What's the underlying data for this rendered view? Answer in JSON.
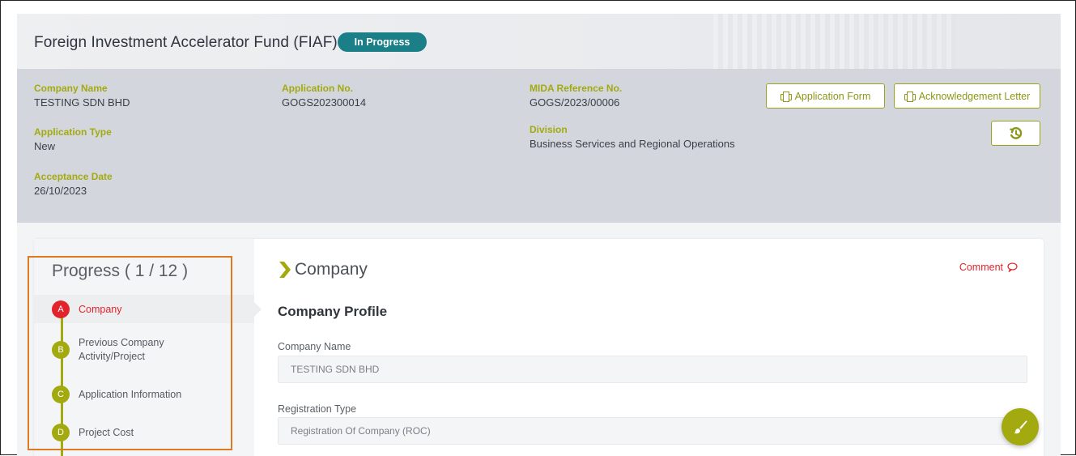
{
  "header": {
    "title": "Foreign Investment Accelerator Fund (FIAF)",
    "status": "In Progress"
  },
  "info": {
    "company_name": {
      "label": "Company Name",
      "value": "TESTING SDN BHD"
    },
    "application_type": {
      "label": "Application Type",
      "value": "New"
    },
    "acceptance_date": {
      "label": "Acceptance Date",
      "value": "26/10/2023"
    },
    "application_no": {
      "label": "Application No.",
      "value": "GOGS202300014"
    },
    "mida_ref": {
      "label": "MIDA Reference No.",
      "value": "GOGS/2023/00006"
    },
    "division": {
      "label": "Division",
      "value": "Business Services and Regional Operations"
    }
  },
  "actions": {
    "application_form": "Application Form",
    "acknowledgement_letter": "Acknowledgement Letter"
  },
  "progress": {
    "title": "Progress ( 1 / 12 )",
    "steps": [
      {
        "letter": "A",
        "label": "Company",
        "active": true
      },
      {
        "letter": "B",
        "label": "Previous Company Activity/Project",
        "active": false
      },
      {
        "letter": "C",
        "label": "Application Information",
        "active": false
      },
      {
        "letter": "D",
        "label": "Project Cost",
        "active": false
      }
    ]
  },
  "content": {
    "section_title": "Company",
    "comment_label": "Comment",
    "subsection_title": "Company Profile",
    "fields": [
      {
        "label": "Company Name",
        "value": "TESTING SDN BHD"
      },
      {
        "label": "Registration Type",
        "value": "Registration Of Company (ROC)"
      }
    ]
  },
  "colors": {
    "accent": "#a3aa10",
    "badge": "#1a7f86",
    "active": "#e2232b",
    "highlight": "#e07a21"
  },
  "icons": {
    "printer": "printer-icon",
    "history": "history-icon",
    "chevron": "chevron-right-icon",
    "comment": "comment-icon",
    "brush": "paint-brush-icon"
  }
}
